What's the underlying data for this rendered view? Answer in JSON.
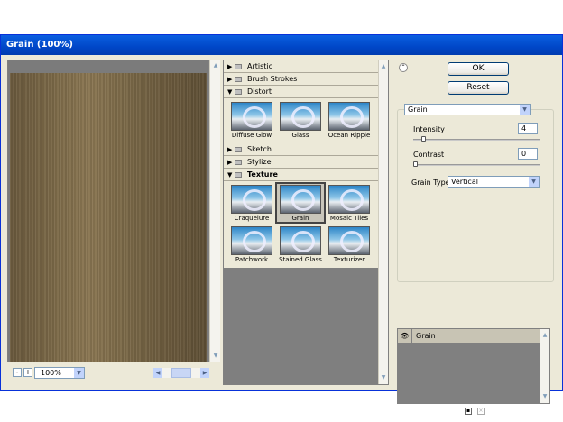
{
  "window": {
    "title": "Grain (100%)"
  },
  "preview": {
    "zoom_minus": "-",
    "zoom_plus": "+",
    "zoom": "100%"
  },
  "tree": {
    "folders": [
      {
        "label": "Artistic",
        "expanded": false
      },
      {
        "label": "Brush Strokes",
        "expanded": false
      },
      {
        "label": "Distort",
        "expanded": true,
        "filters": [
          "Diffuse Glow",
          "Glass",
          "Ocean Ripple"
        ]
      },
      {
        "label": "Sketch",
        "expanded": false
      },
      {
        "label": "Stylize",
        "expanded": false
      },
      {
        "label": "Texture",
        "expanded": true,
        "selected": true,
        "filters": [
          "Craquelure",
          "Grain",
          "Mosaic Tiles",
          "Patchwork",
          "Stained Glass",
          "Texturizer"
        ],
        "selected_filter": "Grain"
      }
    ]
  },
  "buttons": {
    "ok": "OK",
    "reset": "Reset"
  },
  "settings": {
    "filter_select": "Grain",
    "intensity_label": "Intensity",
    "intensity_value": "4",
    "contrast_label": "Contrast",
    "contrast_value": "0",
    "grain_type_label": "Grain Type:",
    "grain_type_value": "Vertical"
  },
  "slider_levels": {
    "intensity": 0.04,
    "contrast": 0.0
  },
  "layers": [
    {
      "label": "Grain",
      "visible": true
    }
  ],
  "icons": {
    "collapse": "double-chevron-up-icon",
    "folder": "folder-icon",
    "eye": "eye-icon",
    "new_layer": "new-effect-layer-icon",
    "delete": "trash-icon"
  }
}
